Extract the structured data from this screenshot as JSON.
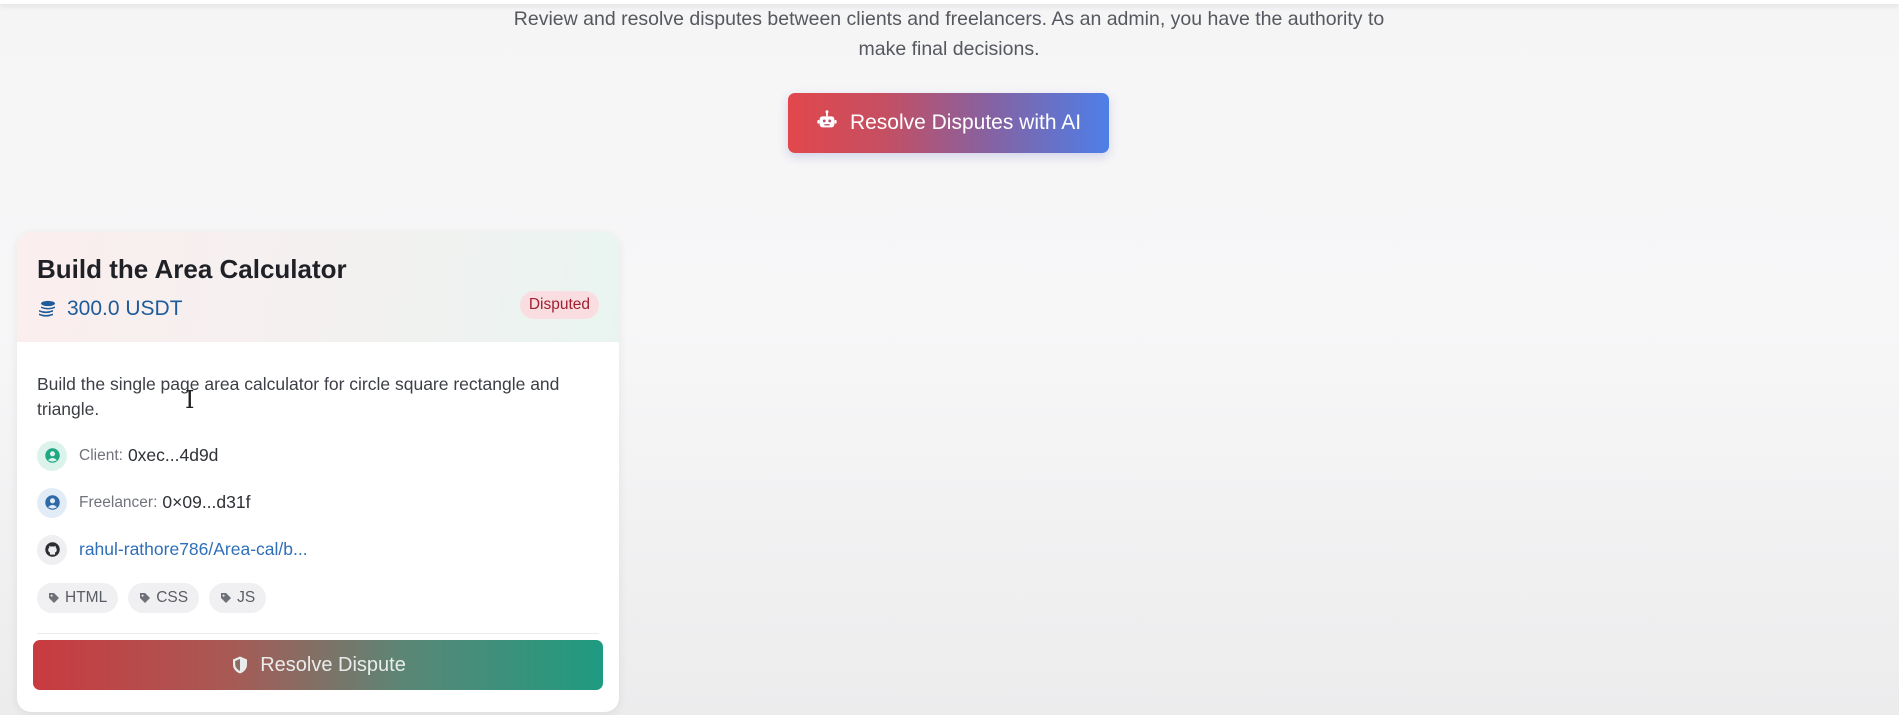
{
  "page": {
    "subtitle": "Review and resolve disputes between clients and freelancers. As an admin, you have the authority to make final decisions.",
    "ai_button_label": "Resolve Disputes with AI",
    "ai_button_icon": "robot-icon"
  },
  "dispute_card": {
    "title": "Build the Area Calculator",
    "amount": "300.0 USDT",
    "amount_icon": "coins-icon",
    "status": "Disputed",
    "description": "Build the single page area calculator for circle square rectangle and triangle.",
    "client_label": "Client:",
    "client_value": "0xec...4d9d",
    "freelancer_label": "Freelancer:",
    "freelancer_value": "0×09...d31f",
    "repo_link": "rahul-rathore786/Area-cal/b...",
    "tags": [
      "HTML",
      "CSS",
      "JS"
    ],
    "resolve_label": "Resolve Dispute",
    "resolve_icon": "shield-icon"
  },
  "colors": {
    "ai_gradient_start": "#e2474c",
    "ai_gradient_end": "#4d7fe8",
    "resolve_gradient_start": "#c93a3f",
    "resolve_gradient_end": "#1e9b80",
    "amount": "#1e5b9a",
    "badge_text": "#a0202f",
    "link": "#2f6fb8"
  }
}
